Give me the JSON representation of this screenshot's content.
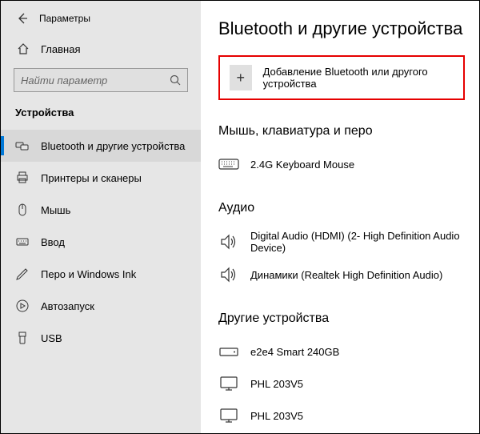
{
  "app": {
    "title": "Параметры"
  },
  "home": {
    "label": "Главная"
  },
  "search": {
    "placeholder": "Найти параметр"
  },
  "sidebar": {
    "section": "Устройства",
    "items": [
      {
        "label": "Bluetooth и другие устройства",
        "icon": "bluetooth"
      },
      {
        "label": "Принтеры и сканеры",
        "icon": "printer"
      },
      {
        "label": "Мышь",
        "icon": "mouse"
      },
      {
        "label": "Ввод",
        "icon": "keyboard"
      },
      {
        "label": "Перо и Windows Ink",
        "icon": "pen"
      },
      {
        "label": "Автозапуск",
        "icon": "autoplay"
      },
      {
        "label": "USB",
        "icon": "usb"
      }
    ]
  },
  "page": {
    "title": "Bluetooth и другие устройства"
  },
  "add_device": {
    "label": "Добавление Bluetooth или другого устройства"
  },
  "sections": [
    {
      "header": "Мышь, клавиатура и перо",
      "devices": [
        {
          "label": "2.4G Keyboard Mouse",
          "icon": "keyboard-dev"
        }
      ]
    },
    {
      "header": "Аудио",
      "devices": [
        {
          "label": "Digital Audio (HDMI) (2- High Definition Audio Device)",
          "icon": "speaker"
        },
        {
          "label": "Динамики (Realtek High Definition Audio)",
          "icon": "speaker"
        }
      ]
    },
    {
      "header": "Другие устройства",
      "devices": [
        {
          "label": "e2e4 Smart 240GB",
          "icon": "drive"
        },
        {
          "label": "PHL 203V5",
          "icon": "monitor"
        },
        {
          "label": "PHL 203V5",
          "icon": "monitor"
        }
      ]
    }
  ]
}
